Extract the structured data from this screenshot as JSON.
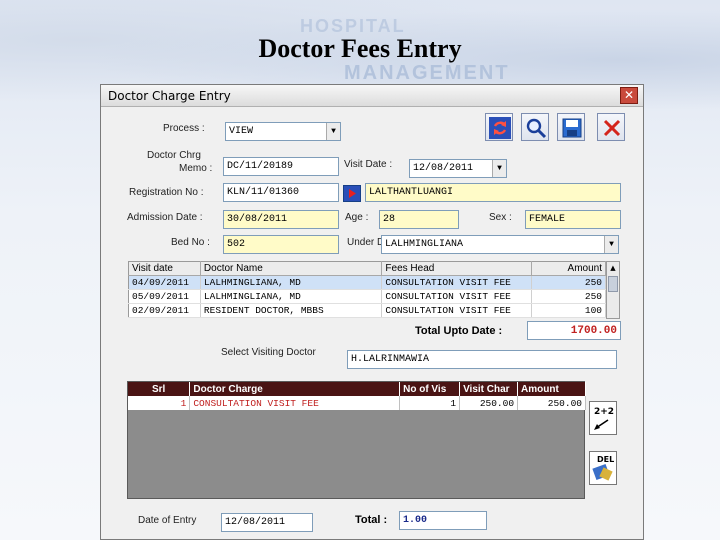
{
  "slide": {
    "title": "Doctor Fees Entry",
    "bg_text_1": "HOSPITAL",
    "bg_text_2": "MANAGEMENT"
  },
  "window": {
    "title": "Doctor Charge Entry"
  },
  "toolbar": {
    "refresh_icon": "refresh-icon",
    "search_icon": "search-icon",
    "save_icon": "save-icon",
    "close_icon": "close-icon"
  },
  "form": {
    "process_label": "Process :",
    "process_value": "VIEW",
    "memo_label_1": "Doctor Chrg",
    "memo_label_2": "Memo :",
    "memo_value": "DC/11/20189",
    "visit_date_label": "Visit Date :",
    "visit_date_value": "12/08/2011",
    "reg_label": "Registration No :",
    "reg_value": "KLN/11/01360",
    "patient_name": "LALTHANTLUANGI",
    "adm_label": "Admission Date :",
    "adm_value": "30/08/2011",
    "age_label": "Age :",
    "age_value": "28",
    "sex_label": "Sex :",
    "sex_value": "FEMALE",
    "bed_label": "Bed No :",
    "bed_value": "502",
    "under_label": "Under Dr. :",
    "under_value": "LALHMINGLIANA"
  },
  "history": {
    "columns": [
      "Visit date",
      "Doctor Name",
      "Fees Head",
      "Amount"
    ],
    "rows": [
      [
        "04/09/2011",
        "LALHMINGLIANA, MD",
        "CONSULTATION VISIT FEE",
        "250"
      ],
      [
        "05/09/2011",
        "LALHMINGLIANA, MD",
        "CONSULTATION VISIT FEE",
        "250"
      ],
      [
        "02/09/2011",
        "RESIDENT DOCTOR, MBBS",
        "CONSULTATION VISIT FEE",
        "100"
      ]
    ],
    "total_label": "Total Upto Date :",
    "total_value": "1700.00"
  },
  "visiting": {
    "label": "Select Visiting Doctor",
    "value": "H.LALRINMAWIA"
  },
  "charges": {
    "columns": [
      "Srl",
      "Doctor Charge",
      "No of Vis",
      "Visit Char",
      "Amount"
    ],
    "rows": [
      [
        "1",
        "CONSULTATION VISIT FEE",
        "1",
        "250.00",
        "250.00"
      ]
    ],
    "calc_label": "2+2 =",
    "del_label": "DEL"
  },
  "footer": {
    "date_label": "Date of Entry",
    "date_value": "12/08/2011",
    "total_label": "Total :",
    "total_value": "1.00"
  },
  "colors": {
    "accent_red": "#c0201f",
    "grid_header": "#4a1414",
    "field_yellow": "#fffbc8"
  }
}
